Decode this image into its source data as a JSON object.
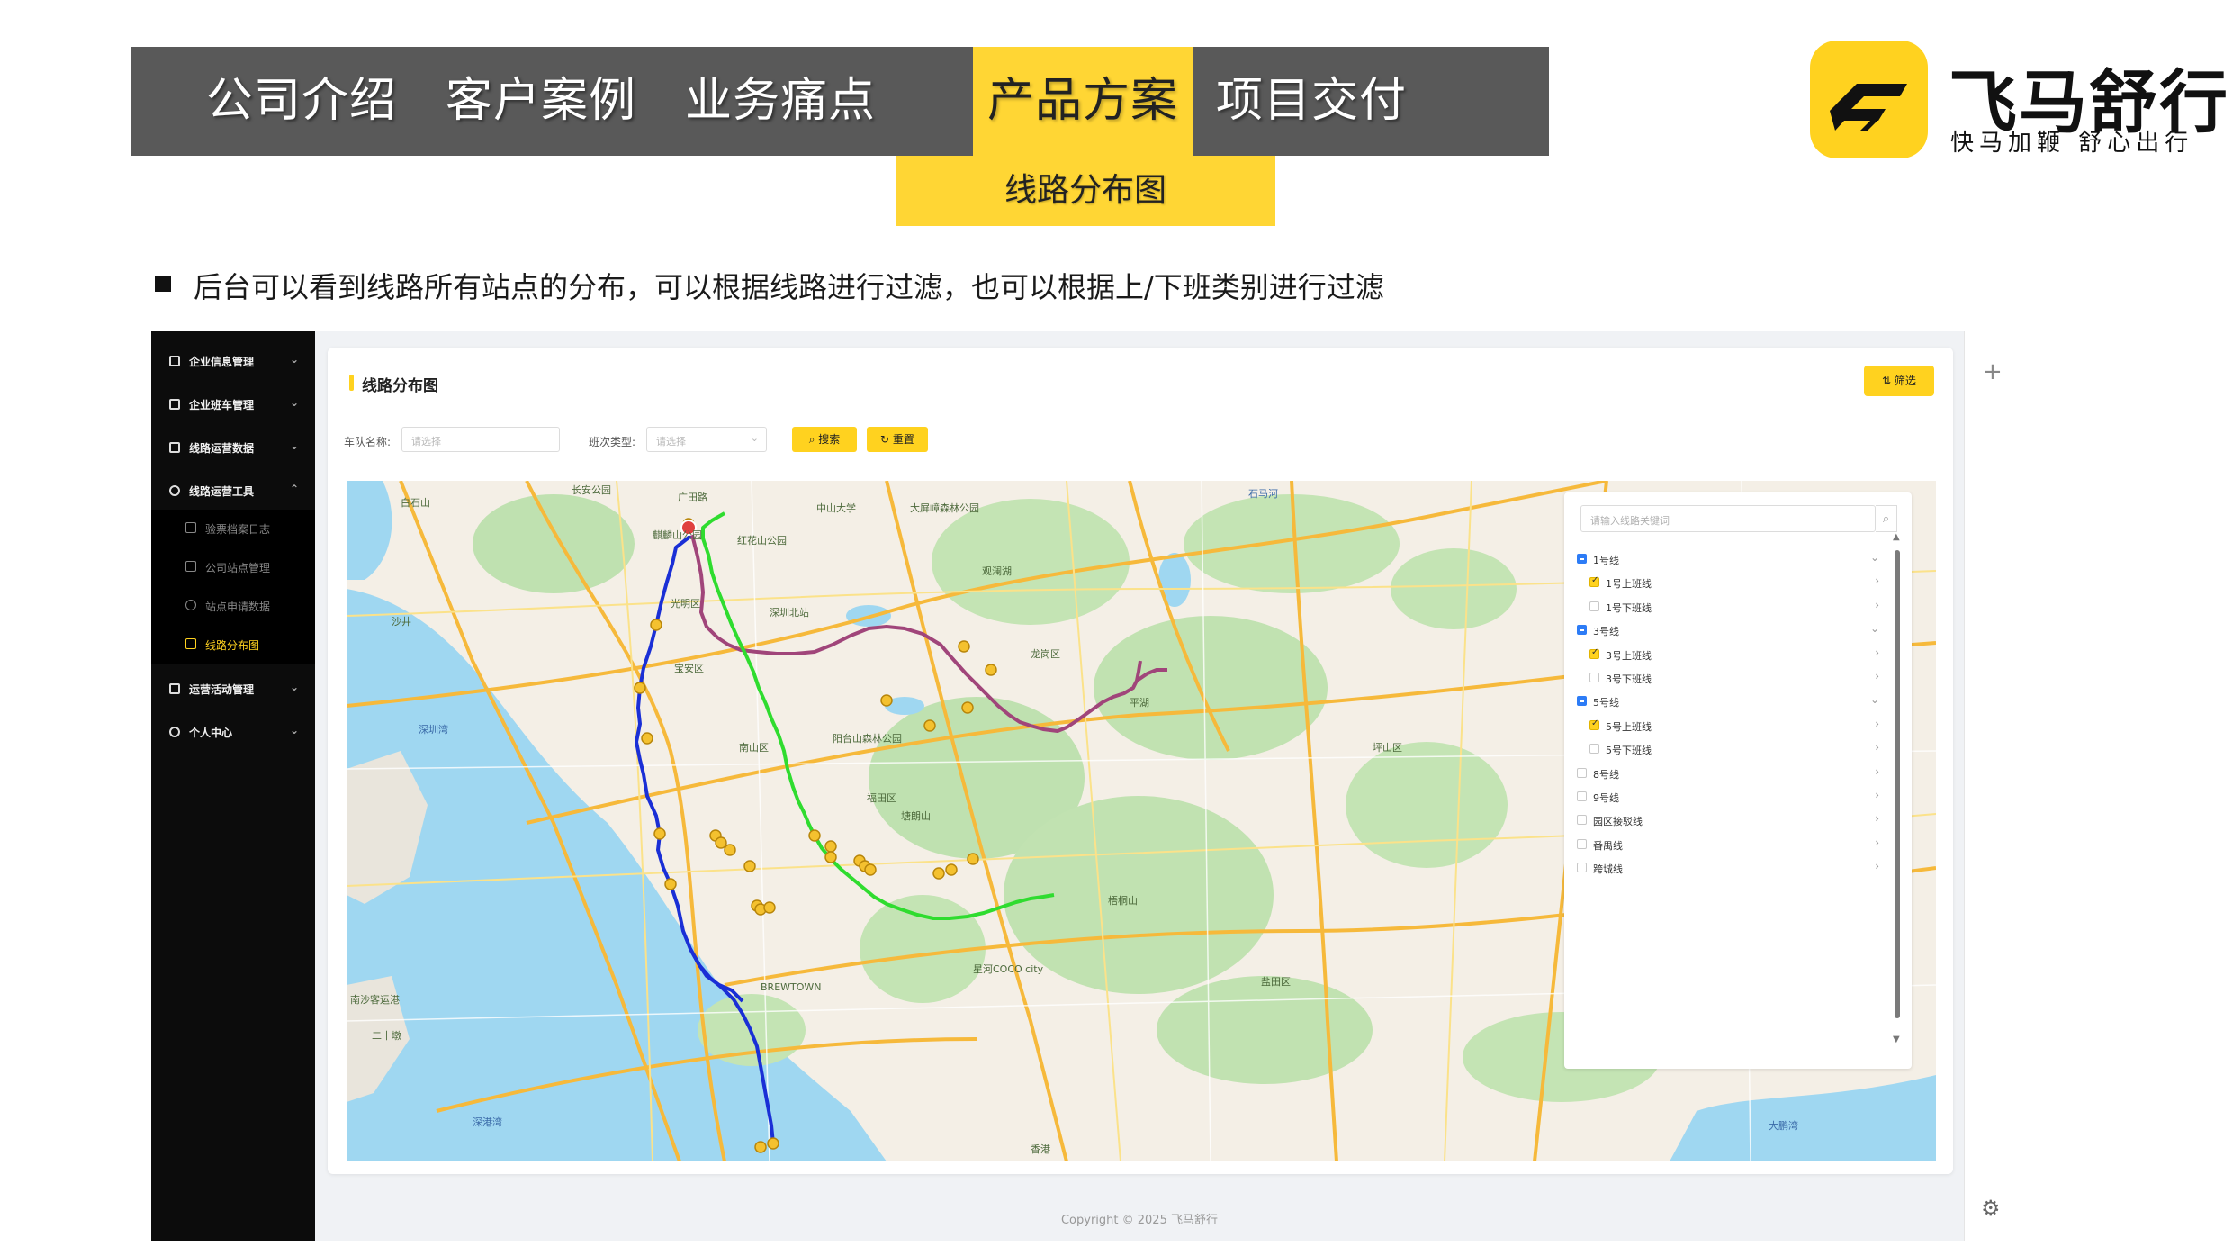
{
  "nav": {
    "tabs": [
      {
        "label": "公司介绍",
        "active": false
      },
      {
        "label": "客户案例",
        "active": false
      },
      {
        "label": "业务痛点",
        "active": false
      },
      {
        "label": "产品方案",
        "active": true
      },
      {
        "label": "项目交付",
        "active": false
      }
    ],
    "subtab": "线路分布图"
  },
  "brand": {
    "name": "飞马舒行",
    "slogan": "快马加鞭  舒心出行",
    "color": "#ffd21f",
    "logo_icon": "flying-horse-logo-icon"
  },
  "bullet": {
    "text": "后台可以看到线路所有站点的分布，可以根据线路进行过滤，也可以根据上/下班类别进行过滤"
  },
  "app": {
    "sidebar": {
      "items": [
        {
          "label": "企业信息管理",
          "icon": "building-icon"
        },
        {
          "label": "企业班车管理",
          "icon": "bus-icon"
        },
        {
          "label": "线路运营数据",
          "icon": "chart-icon"
        },
        {
          "label": "线路运营工具",
          "icon": "tool-icon",
          "expanded": true
        },
        {
          "label": "运营活动管理",
          "icon": "activity-icon"
        },
        {
          "label": "个人中心",
          "icon": "user-icon"
        }
      ],
      "sub_items": [
        {
          "label": "验票档案日志",
          "icon": "ticket-icon"
        },
        {
          "label": "公司站点管理",
          "icon": "station-icon"
        },
        {
          "label": "站点申请数据",
          "icon": "location-icon"
        },
        {
          "label": "线路分布图",
          "icon": "line-chart-icon",
          "active": true
        }
      ]
    },
    "page_title": "线路分布图",
    "filter_button": "筛选",
    "filters": {
      "team_label": "车队名称:",
      "team_placeholder": "请选择",
      "shift_label": "班次类型:",
      "shift_placeholder": "请选择",
      "search_button": "搜索",
      "reset_button": "重置"
    },
    "route_panel": {
      "search_placeholder": "请输入线路关键词",
      "routes": [
        {
          "label": "1号线",
          "level": 0,
          "state": "half",
          "arrow": "⌄"
        },
        {
          "label": "1号上班线",
          "level": 1,
          "state": "on",
          "arrow": "›"
        },
        {
          "label": "1号下班线",
          "level": 1,
          "state": "off",
          "arrow": "›"
        },
        {
          "label": "3号线",
          "level": 0,
          "state": "half",
          "arrow": "⌄"
        },
        {
          "label": "3号上班线",
          "level": 1,
          "state": "on",
          "arrow": "›"
        },
        {
          "label": "3号下班线",
          "level": 1,
          "state": "off",
          "arrow": "›"
        },
        {
          "label": "5号线",
          "level": 0,
          "state": "half",
          "arrow": "⌄"
        },
        {
          "label": "5号上班线",
          "level": 1,
          "state": "on",
          "arrow": "›"
        },
        {
          "label": "5号下班线",
          "level": 1,
          "state": "off",
          "arrow": "›"
        },
        {
          "label": "8号线",
          "level": 0,
          "state": "off",
          "arrow": "›"
        },
        {
          "label": "9号线",
          "level": 0,
          "state": "off",
          "arrow": "›"
        },
        {
          "label": "园区接驳线",
          "level": 0,
          "state": "off",
          "arrow": "›"
        },
        {
          "label": "番禺线",
          "level": 0,
          "state": "off",
          "arrow": "›"
        },
        {
          "label": "跨城线",
          "level": 0,
          "state": "off",
          "arrow": "›"
        }
      ]
    },
    "map": {
      "route_colors": {
        "blue": "#1a2fd6",
        "purple": "#a0457a",
        "green": "#2fdc2f"
      },
      "labels": {
        "l1": "白石山",
        "l2": "长安公园",
        "l3": "广田路",
        "l4": "中山大学",
        "l5": "大屏嶂森林公园",
        "l6": "观澜湖",
        "l7": "石马河",
        "l8": "麒麟山公园",
        "l9": "红花山公园",
        "l10": "深圳湾",
        "l11": "宝安区",
        "l12": "南山区",
        "l13": "福田区",
        "l14": "龙岗区",
        "l15": "阳台山森林公园",
        "l16": "塘朗山",
        "l17": "大鹏湾",
        "l18": "深港湾",
        "l19": "梧桐山",
        "l20": "盐田区",
        "l21": "二十墩",
        "l22": "南沙客运港",
        "l23": "香港",
        "l24": "深圳北站",
        "l25": "光明区",
        "l26": "平湖",
        "l27": "坪山区",
        "l28": "BREWTOWN",
        "l29": "星河COCO city",
        "l30": "沙井"
      }
    },
    "copyright": "Copyright © 2025 飞马舒行"
  }
}
